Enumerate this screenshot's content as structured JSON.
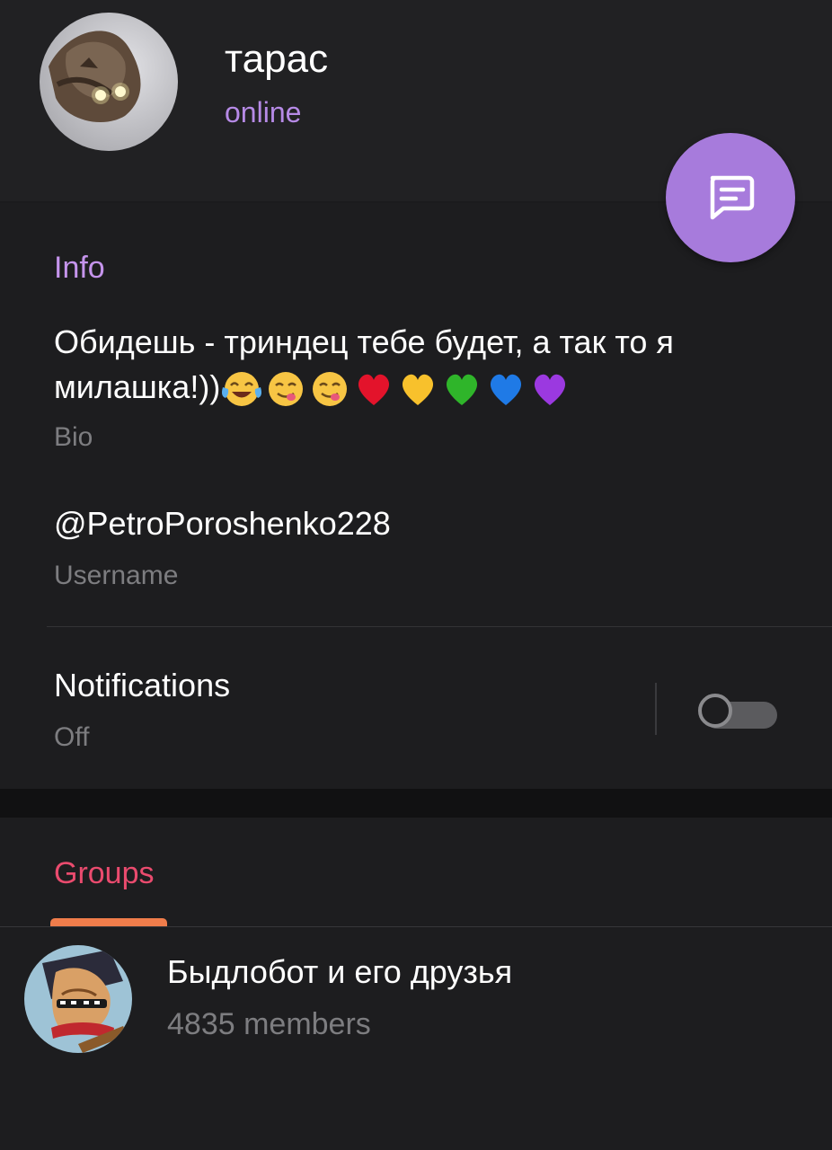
{
  "profile": {
    "name": "тарас",
    "status": "online"
  },
  "fab": {
    "icon": "message-icon"
  },
  "info": {
    "title": "Info",
    "bio_text": "Обидешь - триндец тебе будет, а так то я милашка!))",
    "bio_emoji": [
      "😂",
      "😋",
      "😋",
      "❤️",
      "💛",
      "💚",
      "💙",
      "💜"
    ],
    "bio_label": "Bio",
    "username": "@PetroPoroshenko228",
    "username_label": "Username",
    "notifications_label": "Notifications",
    "notifications_value": "Off",
    "notifications_enabled": false
  },
  "groups": {
    "title": "Groups",
    "items": [
      {
        "name": "Быдлобот и его друзья",
        "members": "4835 members"
      }
    ]
  },
  "colors": {
    "accent_purple": "#b68ae6",
    "fab": "#a77bdc",
    "groups_title": "#ea4b6e",
    "tab_indicator": "#f07d4b"
  }
}
